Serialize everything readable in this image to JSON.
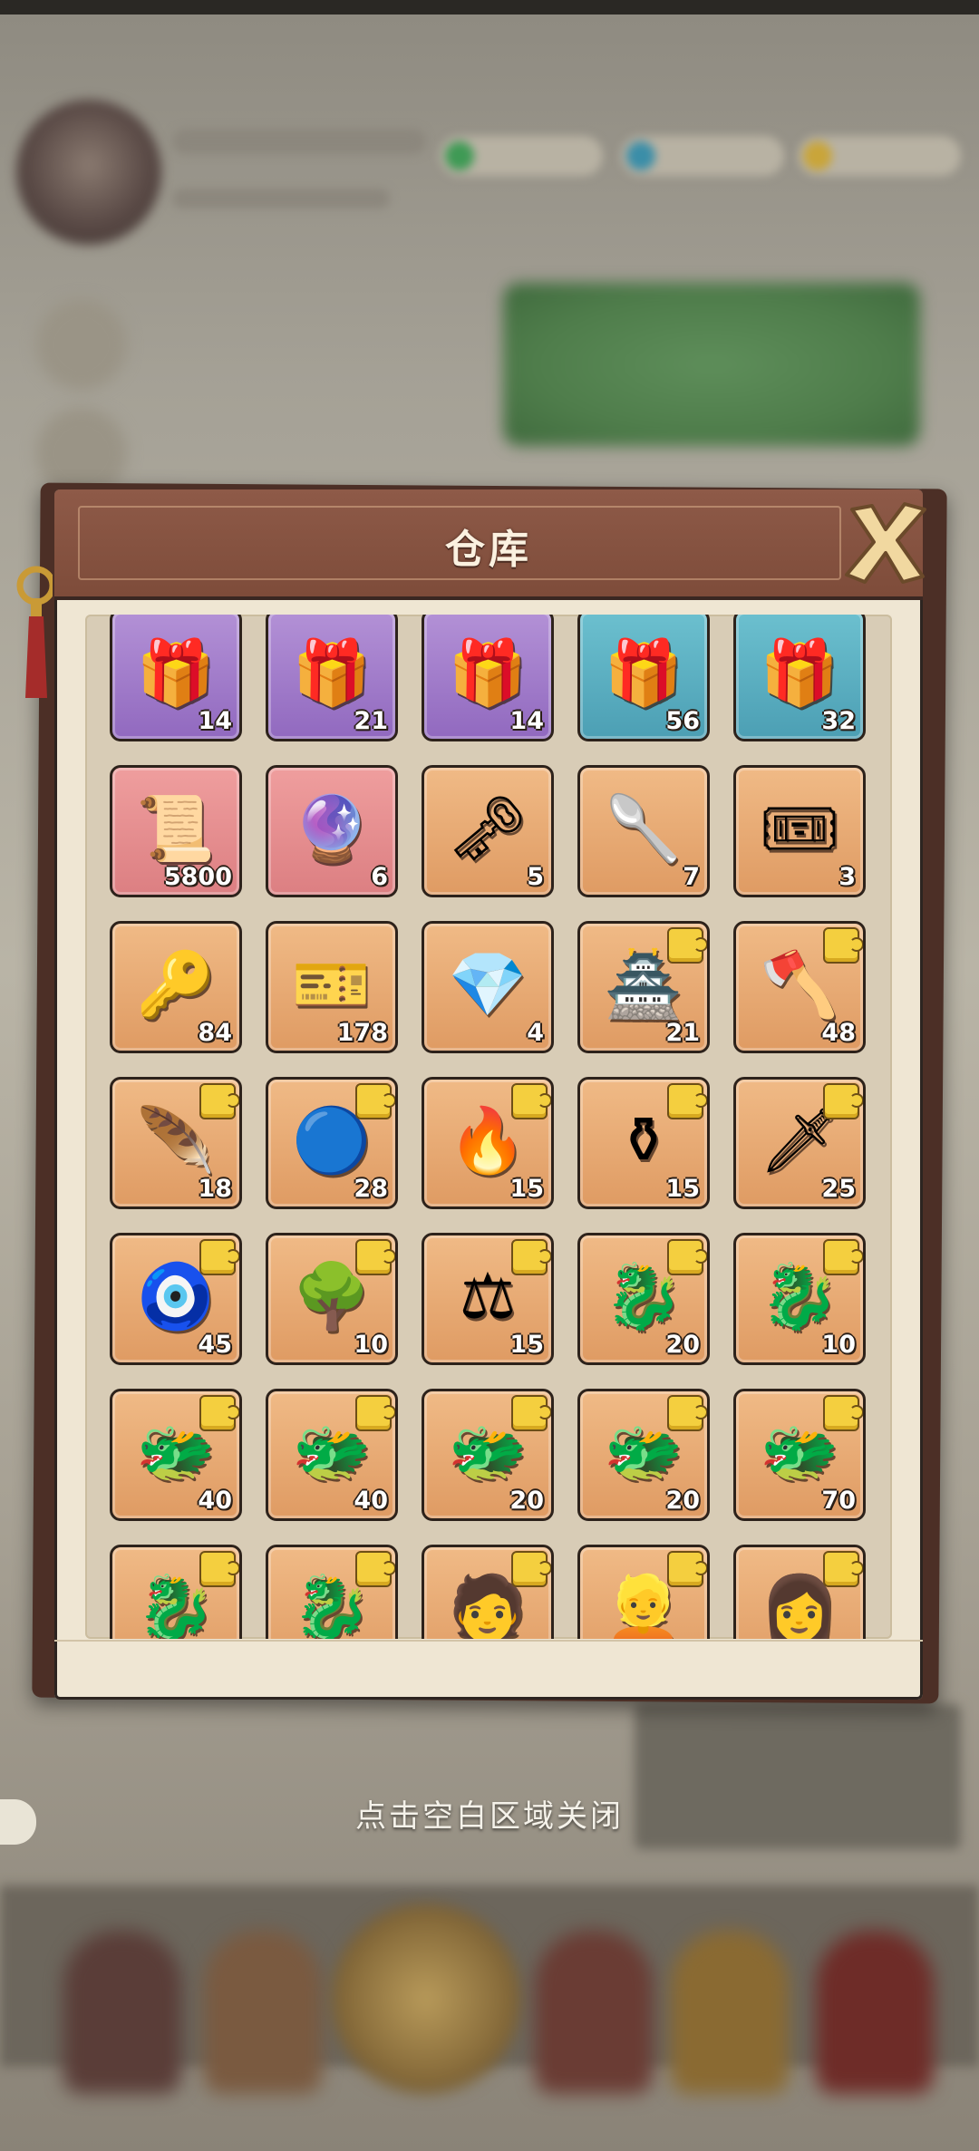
{
  "warehouse": {
    "title": "仓库",
    "close_icon": "close-x-icon",
    "close_hint": "点击空白区域关闭",
    "items": [
      {
        "icon": "chest-icon",
        "glyph": "🎁",
        "count": "14",
        "rarity": "purple",
        "fragment": false
      },
      {
        "icon": "chest-icon",
        "glyph": "🎁",
        "count": "21",
        "rarity": "purple",
        "fragment": false
      },
      {
        "icon": "chest-icon",
        "glyph": "🎁",
        "count": "14",
        "rarity": "purple",
        "fragment": false
      },
      {
        "icon": "chest-icon",
        "glyph": "🎁",
        "count": "56",
        "rarity": "teal",
        "fragment": false
      },
      {
        "icon": "chest-icon",
        "glyph": "🎁",
        "count": "32",
        "rarity": "teal",
        "fragment": false
      },
      {
        "icon": "scroll-icon",
        "glyph": "📜",
        "count": "5800",
        "rarity": "pink",
        "fragment": false
      },
      {
        "icon": "jade-orb-icon",
        "glyph": "🔮",
        "count": "6",
        "rarity": "pink",
        "fragment": false
      },
      {
        "icon": "key-icon",
        "glyph": "🗝",
        "count": "5",
        "rarity": "orange",
        "fragment": false
      },
      {
        "icon": "spoon-icon",
        "glyph": "🥄",
        "count": "7",
        "rarity": "orange",
        "fragment": false
      },
      {
        "icon": "ticket-icon",
        "glyph": "🎟",
        "count": "3",
        "rarity": "orange",
        "fragment": false
      },
      {
        "icon": "key-icon",
        "glyph": "🔑",
        "count": "84",
        "rarity": "orange",
        "fragment": false
      },
      {
        "icon": "ticket-icon",
        "glyph": "🎫",
        "count": "178",
        "rarity": "orange",
        "fragment": false
      },
      {
        "icon": "crystal-icon",
        "glyph": "💎",
        "count": "4",
        "rarity": "orange",
        "fragment": false
      },
      {
        "icon": "pagoda-fragment-icon",
        "glyph": "🏯",
        "count": "21",
        "rarity": "orange",
        "fragment": true
      },
      {
        "icon": "axe-fragment-icon",
        "glyph": "🪓",
        "count": "48",
        "rarity": "orange",
        "fragment": true
      },
      {
        "icon": "fan-fragment-icon",
        "glyph": "🪶",
        "count": "18",
        "rarity": "orange",
        "fragment": true
      },
      {
        "icon": "mirror-fragment-icon",
        "glyph": "🔵",
        "count": "28",
        "rarity": "orange",
        "fragment": true
      },
      {
        "icon": "wheel-fragment-icon",
        "glyph": "🔥",
        "count": "15",
        "rarity": "orange",
        "fragment": true
      },
      {
        "icon": "cauldron-fragment-icon",
        "glyph": "⚱",
        "count": "15",
        "rarity": "orange",
        "fragment": true
      },
      {
        "icon": "sword-fragment-icon",
        "glyph": "🗡",
        "count": "25",
        "rarity": "orange",
        "fragment": true
      },
      {
        "icon": "amulet-fragment-icon",
        "glyph": "🧿",
        "count": "45",
        "rarity": "orange",
        "fragment": true
      },
      {
        "icon": "tree-fragment-icon",
        "glyph": "🌳",
        "count": "10",
        "rarity": "orange",
        "fragment": true
      },
      {
        "icon": "scale-fragment-icon",
        "glyph": "⚖",
        "count": "15",
        "rarity": "orange",
        "fragment": true
      },
      {
        "icon": "dragon-fragment-icon",
        "glyph": "🐉",
        "count": "20",
        "rarity": "orange",
        "fragment": true
      },
      {
        "icon": "dragon-fragment-icon",
        "glyph": "🐉",
        "count": "10",
        "rarity": "orange",
        "fragment": true
      },
      {
        "icon": "dragon-ice-fragment-icon",
        "glyph": "🐲",
        "count": "40",
        "rarity": "orange",
        "fragment": true
      },
      {
        "icon": "dragon-fire-fragment-icon",
        "glyph": "🐲",
        "count": "40",
        "rarity": "orange",
        "fragment": true
      },
      {
        "icon": "dragon-flame-fragment-icon",
        "glyph": "🐲",
        "count": "20",
        "rarity": "orange",
        "fragment": true
      },
      {
        "icon": "dragon-gold-fragment-icon",
        "glyph": "🐲",
        "count": "20",
        "rarity": "orange",
        "fragment": true
      },
      {
        "icon": "dragon-claw-fragment-icon",
        "glyph": "🐲",
        "count": "70",
        "rarity": "orange",
        "fragment": true
      },
      {
        "icon": "dragon-fragment-icon",
        "glyph": "🐉",
        "count": "",
        "rarity": "orange",
        "fragment": true
      },
      {
        "icon": "dragon-fragment-icon",
        "glyph": "🐉",
        "count": "",
        "rarity": "orange",
        "fragment": true
      },
      {
        "icon": "hero-portrait-fragment-icon",
        "glyph": "🧑",
        "count": "",
        "rarity": "orange",
        "fragment": true
      },
      {
        "icon": "hero-portrait-fragment-icon",
        "glyph": "👱",
        "count": "",
        "rarity": "orange",
        "fragment": true
      },
      {
        "icon": "hero-portrait-fragment-icon",
        "glyph": "👩",
        "count": "",
        "rarity": "orange",
        "fragment": true
      }
    ]
  },
  "colors": {
    "panel_header": "#7e4c3a",
    "panel_body": "#efe6d3",
    "fragment_badge": "#f4cf3f"
  }
}
